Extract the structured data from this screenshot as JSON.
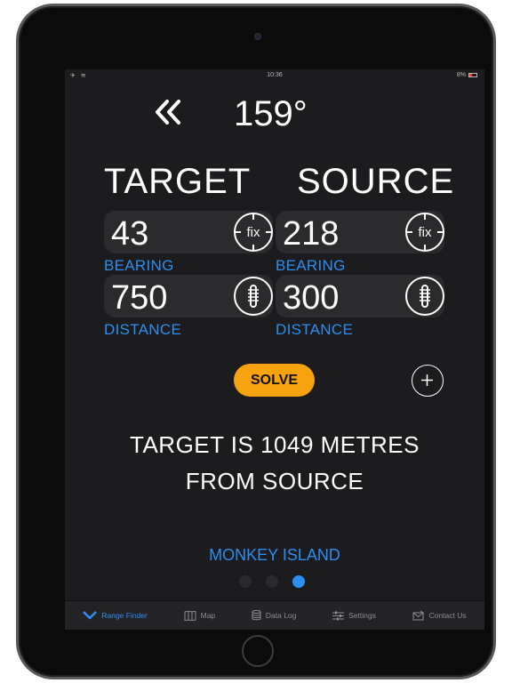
{
  "status_bar": {
    "left": "✈ ≋",
    "time": "10:36",
    "battery": "8%"
  },
  "header": {
    "back_icon": "double-chevron-left-icon",
    "heading": "159°"
  },
  "target": {
    "title": "TARGET",
    "bearing_value": "43",
    "bearing_label": "BEARING",
    "bearing_button": "fix",
    "distance_value": "750",
    "distance_label": "DISTANCE",
    "distance_button_icon": "ruler-icon"
  },
  "source": {
    "title": "SOURCE",
    "bearing_value": "218",
    "bearing_label": "BEARING",
    "bearing_button": "fix",
    "distance_value": "300",
    "distance_label": "DISTANCE",
    "distance_button_icon": "ruler-icon"
  },
  "actions": {
    "solve_label": "SOLVE",
    "add_icon": "plus-icon"
  },
  "result": {
    "line1": "TARGET IS 1049 METRES",
    "line2": "FROM SOURCE"
  },
  "location": "MONKEY ISLAND",
  "pager": {
    "count": 3,
    "active_index": 2
  },
  "tabs": [
    {
      "label": "Range Finder",
      "icon": "chevron-down-icon",
      "active": true
    },
    {
      "label": "Map",
      "icon": "map-icon",
      "active": false
    },
    {
      "label": "Data Log",
      "icon": "database-icon",
      "active": false
    },
    {
      "label": "Settings",
      "icon": "sliders-icon",
      "active": false
    },
    {
      "label": "Contact Us",
      "icon": "envelope-icon",
      "active": false
    }
  ],
  "colors": {
    "accent": "#2c8ff0",
    "solve": "#f7a20f",
    "background": "#1c1c1e"
  }
}
